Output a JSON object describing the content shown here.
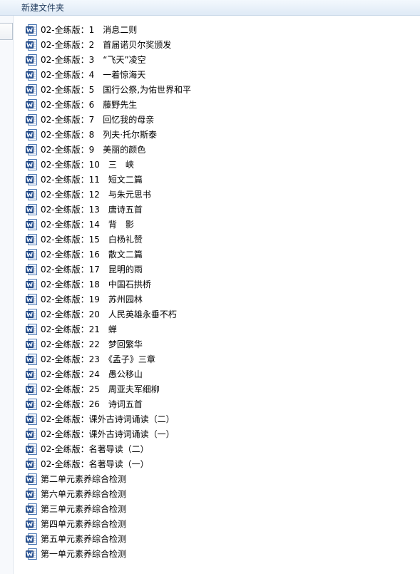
{
  "window": {
    "title": "新建文件夹"
  },
  "icons": {
    "file_icon": "word-document-icon"
  },
  "files": [
    {
      "name": "02-全练版：1　消息二则"
    },
    {
      "name": "02-全练版：2　首届诺贝尔奖颁发"
    },
    {
      "name": "02-全练版：3　“飞天”凌空"
    },
    {
      "name": "02-全练版：4　一着惊海天"
    },
    {
      "name": "02-全练版：5　国行公祭,为佑世界和平"
    },
    {
      "name": "02-全练版：6　藤野先生"
    },
    {
      "name": "02-全练版：7　回忆我的母亲"
    },
    {
      "name": "02-全练版：8　列夫·托尔斯泰"
    },
    {
      "name": "02-全练版：9　美丽的颜色"
    },
    {
      "name": "02-全练版：10　三　峡"
    },
    {
      "name": "02-全练版：11　短文二篇"
    },
    {
      "name": "02-全练版：12　与朱元思书"
    },
    {
      "name": "02-全练版：13　唐诗五首"
    },
    {
      "name": "02-全练版：14　背　影"
    },
    {
      "name": "02-全练版：15　白杨礼赞"
    },
    {
      "name": "02-全练版：16　散文二篇"
    },
    {
      "name": "02-全练版：17　昆明的雨"
    },
    {
      "name": "02-全练版：18　中国石拱桥"
    },
    {
      "name": "02-全练版：19　苏州园林"
    },
    {
      "name": "02-全练版：20　人民英雄永垂不朽"
    },
    {
      "name": "02-全练版：21　蝉"
    },
    {
      "name": "02-全练版：22　梦回繁华"
    },
    {
      "name": "02-全练版：23　《孟子》三章"
    },
    {
      "name": "02-全练版：24　愚公移山"
    },
    {
      "name": "02-全练版：25　周亚夫军细柳"
    },
    {
      "name": "02-全练版：26　诗词五首"
    },
    {
      "name": "02-全练版：课外古诗词诵读（二）"
    },
    {
      "name": "02-全练版：课外古诗词诵读（一）"
    },
    {
      "name": "02-全练版：名著导读（二）"
    },
    {
      "name": "02-全练版：名著导读（一）"
    },
    {
      "name": "第二单元素养综合检测"
    },
    {
      "name": "第六单元素养综合检测"
    },
    {
      "name": "第三单元素养综合检测"
    },
    {
      "name": "第四单元素养综合检测"
    },
    {
      "name": "第五单元素养综合检测"
    },
    {
      "name": "第一单元素养综合检测"
    }
  ]
}
